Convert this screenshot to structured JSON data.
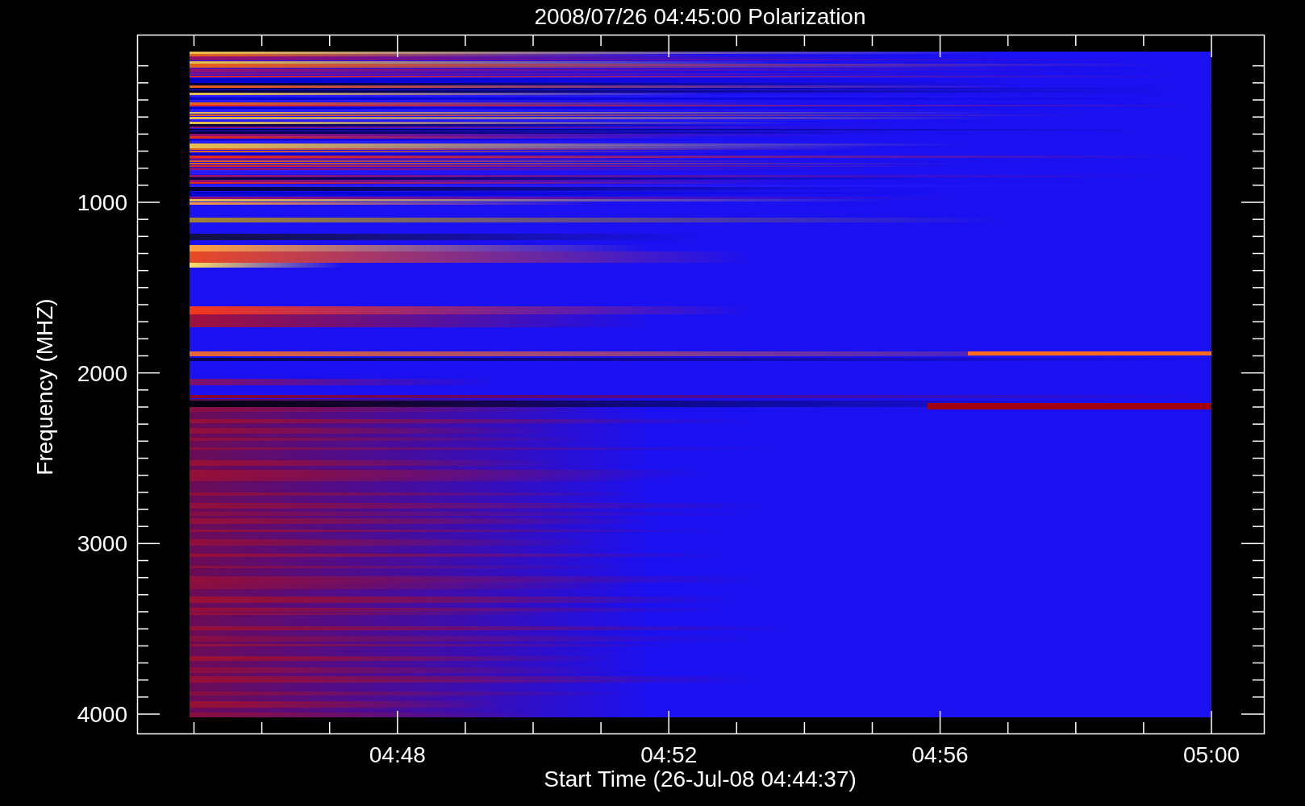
{
  "title": "2008/07/26 04:45:00 Polarization",
  "plot": {
    "ylabel": "Frequency (MHZ)",
    "xlabel": "Start Time (26-Jul-08 04:44:37)",
    "yticks": [
      "1000",
      "2000",
      "3000",
      "4000"
    ],
    "xticks": [
      "04:48",
      "04:52",
      "04:56",
      "05:00"
    ]
  }
}
